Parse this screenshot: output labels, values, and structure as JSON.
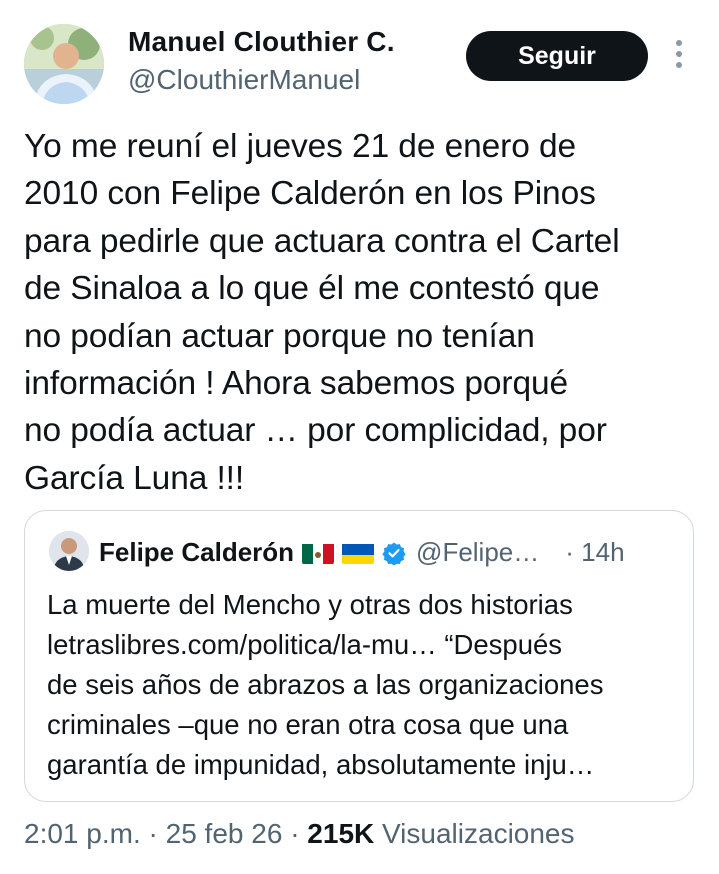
{
  "author": {
    "name": "Manuel Clouthier C.",
    "handle": "@ClouthierManuel"
  },
  "follow_label": "Seguir",
  "tweet_text": "Yo me reuní el jueves 21 de enero de\n2010 con Felipe Calderón en los Pinos\npara pedirle que actuara contra el Cartel\nde Sinaloa a lo que él me contestó que\nno podían actuar porque no tenían\ninformación ! Ahora sabemos porqué\nno podía actuar … por complicidad, por\nGarcía Luna !!!",
  "quote": {
    "name": "Felipe Calderón",
    "handle": "@Felipe…",
    "time": "· 14h",
    "text": "La muerte del Mencho y otras dos historias\nletraslibres.com/politica/la-mu… “Después\nde seis años de abrazos a las organizaciones\ncriminales –que no eran otra cosa que una\ngarantía de impunidad, absolutamente inju…"
  },
  "footer": {
    "time": "2:01 p.m.",
    "date": "25 feb 26",
    "views_count": "215K",
    "views_label": "Visualizaciones"
  },
  "icons": [
    "avatar",
    "more-icon",
    "mexico-flag-icon",
    "ukraine-flag-icon",
    "verified-icon"
  ],
  "colors": {
    "primary_text": "#0f1419",
    "secondary_text": "#536471",
    "verified": "#1d9bf0",
    "border": "#cfd9de"
  }
}
